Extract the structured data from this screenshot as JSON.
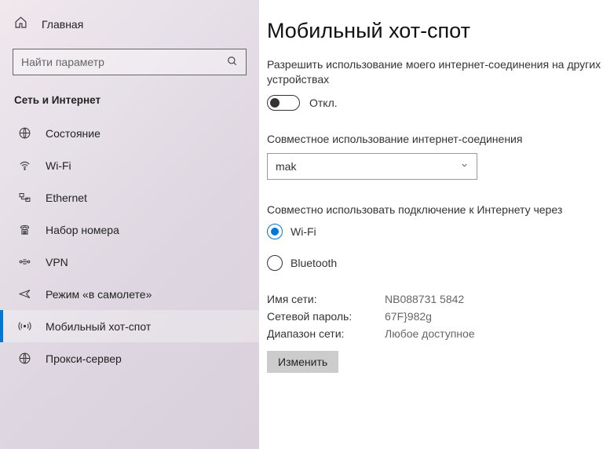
{
  "sidebar": {
    "home_label": "Главная",
    "search_placeholder": "Найти параметр",
    "category": "Сеть и Интернет",
    "items": [
      {
        "label": "Состояние",
        "active": false
      },
      {
        "label": "Wi-Fi",
        "active": false
      },
      {
        "label": "Ethernet",
        "active": false
      },
      {
        "label": "Набор номера",
        "active": false
      },
      {
        "label": "VPN",
        "active": false
      },
      {
        "label": "Режим «в самолете»",
        "active": false
      },
      {
        "label": "Мобильный хот-спот",
        "active": true
      },
      {
        "label": "Прокси-сервер",
        "active": false
      }
    ]
  },
  "main": {
    "title": "Мобильный хот-спот",
    "description": "Разрешить использование моего интернет-соединения на других устройствах",
    "toggle_state": "Откл.",
    "share_label": "Совместное использование интернет-соединения",
    "share_value": "mak",
    "share_over_label": "Совместно использовать подключение к Интернету через",
    "radio_wifi": "Wi-Fi",
    "radio_bluetooth": "Bluetooth",
    "info": {
      "network_name_key": "Имя сети:",
      "network_name_val": "NB088731 5842",
      "password_key": "Сетевой пароль:",
      "password_val": "67F}982g",
      "band_key": "Диапазон сети:",
      "band_val": "Любое доступное"
    },
    "edit_button": "Изменить"
  }
}
